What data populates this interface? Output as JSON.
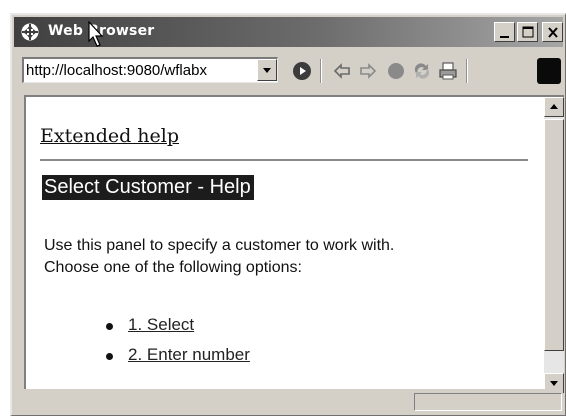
{
  "window": {
    "title": "Web Browser",
    "controls": {
      "minimize": "minimize-icon",
      "maximize": "maximize-icon",
      "close": "close-icon"
    }
  },
  "toolbar": {
    "url": "http://localhost:9080/wflabx",
    "icons": [
      "go-icon",
      "back-icon",
      "forward-icon",
      "stop-icon",
      "refresh-icon",
      "print-icon",
      "busy-indicator-icon"
    ]
  },
  "page": {
    "extended_help_link": "Extended help",
    "heading": "Select Customer - Help",
    "paragraph_line1": "Use this panel to specify a customer to work with.",
    "paragraph_line2": "Choose one of the following options:",
    "options": [
      {
        "label": "1. Select"
      },
      {
        "label": "2. Enter number"
      }
    ]
  },
  "colors": {
    "heading_bg": "#1c1c1c",
    "chrome": "#d4d0c8"
  }
}
